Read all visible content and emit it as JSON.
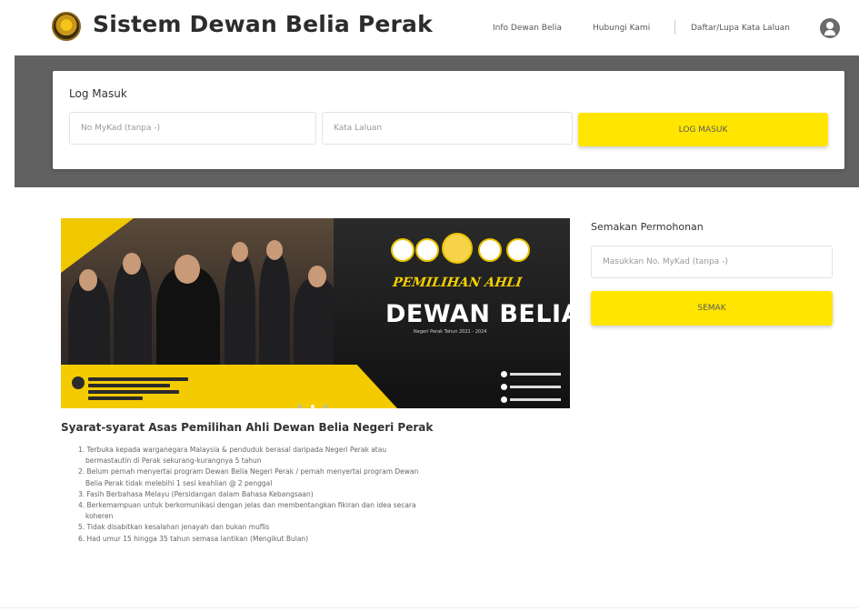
{
  "header": {
    "title": "Sistem Dewan Belia Perak",
    "nav": [
      "Info Dewan Belia",
      "Hubungi Kami",
      "Daftar/Lupa Kata Laluan"
    ]
  },
  "login": {
    "title": "Log Masuk",
    "mykad_placeholder": "No MyKad (tanpa -)",
    "password_placeholder": "Kata Laluan",
    "button": "LOG MASUK"
  },
  "banner": {
    "script_title": "PEMILIHAN AHLI",
    "big_title": "DEWAN BELIA",
    "subtitle": "Negeri Perak Tahun 2021 - 2024"
  },
  "semakan": {
    "title": "Semakan Permohonan",
    "placeholder": "Masukkan No. MyKad (tanpa -)",
    "button": "SEMAK"
  },
  "syarat": {
    "title": "Syarat-syarat Asas Pemilihan Ahli Dewan Belia Negeri Perak",
    "items": [
      "1. Terbuka kepada warganegara Malaysia & penduduk berasal daripada Negeri Perak atau",
      "bermastautin di Perak sekurang-kurangnya 5 tahun",
      "2. Belum pernah menyertai program Dewan Belia Negeri Perak / pernah menyertai program Dewan",
      "Belia Perak tidak melebihi 1 sesi keahlian @ 2 penggal",
      "3. Fasih Berbahasa Melayu (Persidangan dalam Bahasa Kebangsaan)",
      "4. Berkemampuan untuk berkomunikasi dengan jelas dan membentangkan fikiran dan idea secara",
      "koheren",
      "5. Tidak disabitkan kesalahan jenayah dan bukan muflis",
      "6. Had umur 15 hingga 35 tahun semasa lantikan (Mengikut Bulan)"
    ]
  }
}
